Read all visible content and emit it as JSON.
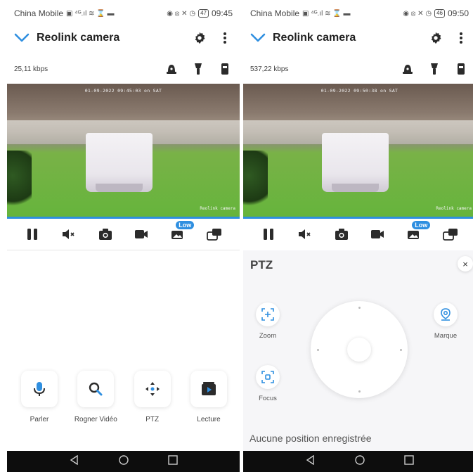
{
  "left": {
    "status": {
      "carrier": "China Mobile",
      "battery": "47",
      "time": "09:45"
    },
    "app_title": "Reolink camera",
    "kbps": "25,11 kbps",
    "video": {
      "timestamp": "01-09-2022 09:45:03 on SAT",
      "brand": "Reolink camera"
    },
    "low_badge": "Low",
    "actions": [
      {
        "label": "Parler",
        "icon": "microphone-icon"
      },
      {
        "label": "Rogner Vidéo",
        "icon": "crop-search-icon"
      },
      {
        "label": "PTZ",
        "icon": "ptz-arrows-icon"
      },
      {
        "label": "Lecture",
        "icon": "playback-icon"
      }
    ]
  },
  "right": {
    "status": {
      "carrier": "China Mobile",
      "battery": "46",
      "time": "09:50"
    },
    "app_title": "Reolink camera",
    "kbps": "537,22 kbps",
    "video": {
      "timestamp": "01-09-2022 09:50:38 on SAT",
      "brand": "Reolink camera"
    },
    "low_badge": "Low",
    "ptz": {
      "title": "PTZ",
      "close": "×",
      "zoom_label": "Zoom",
      "focus_label": "Focus",
      "mark_label": "Marque",
      "no_positions": "Aucune position enregistrée"
    }
  },
  "colors": {
    "accent": "#2f8fe0",
    "nav_bar": "#0d0d0d"
  }
}
